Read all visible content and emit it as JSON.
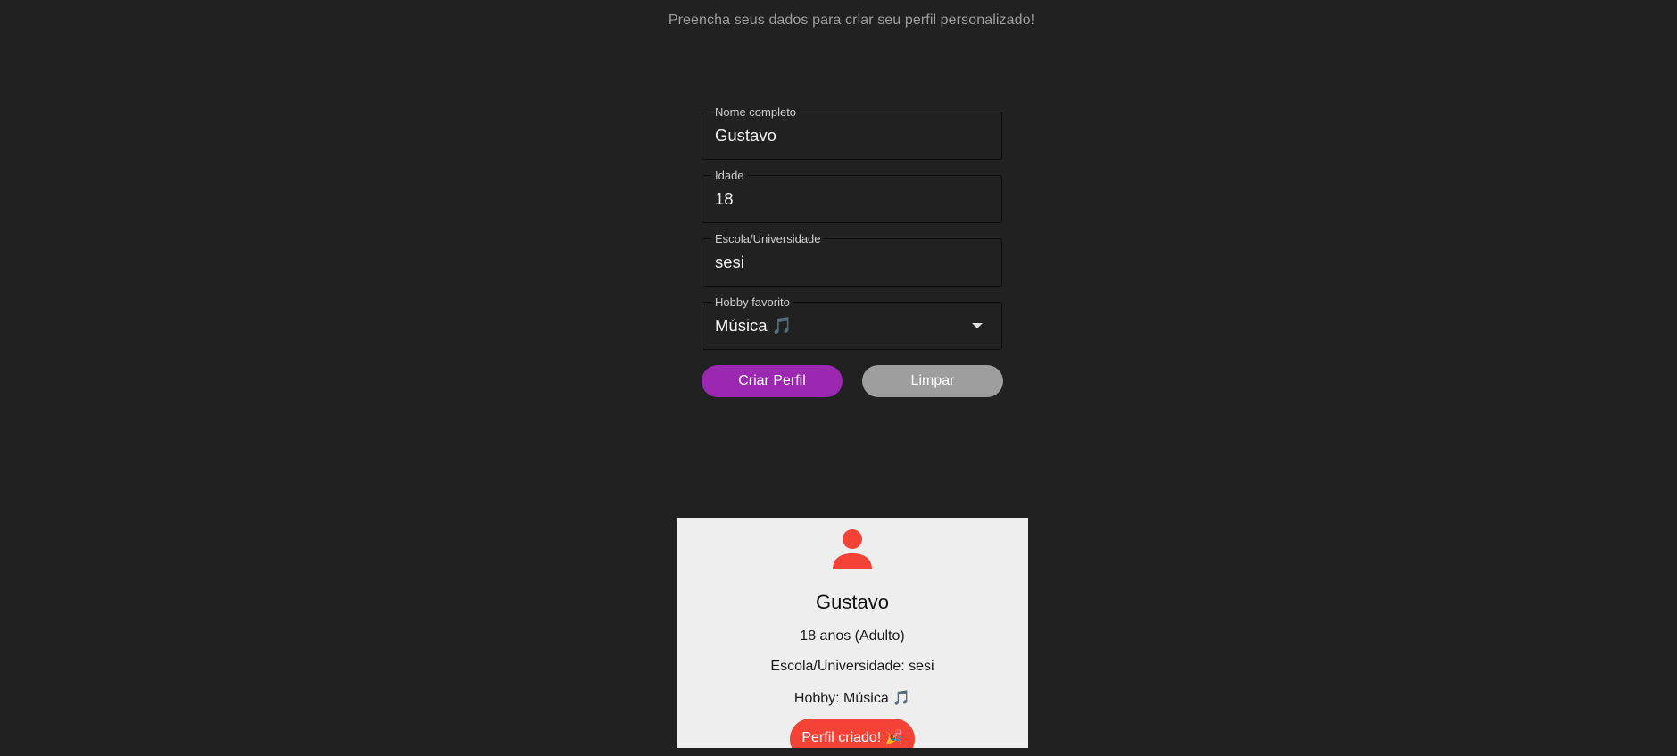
{
  "header": {
    "subtitle": "Preencha seus dados para criar seu perfil personalizado!"
  },
  "form": {
    "name": {
      "label": "Nome completo",
      "value": "Gustavo"
    },
    "age": {
      "label": "Idade",
      "value": "18"
    },
    "school": {
      "label": "Escola/Universidade",
      "value": "sesi"
    },
    "hobby": {
      "label": "Hobby favorito",
      "selected": "Música 🎵",
      "icon": "chevron-down-icon"
    },
    "buttons": {
      "create_label": "Criar Perfil",
      "clear_label": "Limpar"
    }
  },
  "profile_card": {
    "avatar_icon": "person-icon",
    "name": "Gustavo",
    "age_line": "18 anos (Adulto)",
    "school_line": "Escola/Universidade: sesi",
    "hobby_line": "Hobby: Música 🎵",
    "badge": "Perfil criado! 🎉"
  },
  "colors": {
    "background": "#212121",
    "primary": "#9c27b0",
    "secondary": "#9e9e9e",
    "accent": "#f44336",
    "card": "#eeeeee"
  }
}
